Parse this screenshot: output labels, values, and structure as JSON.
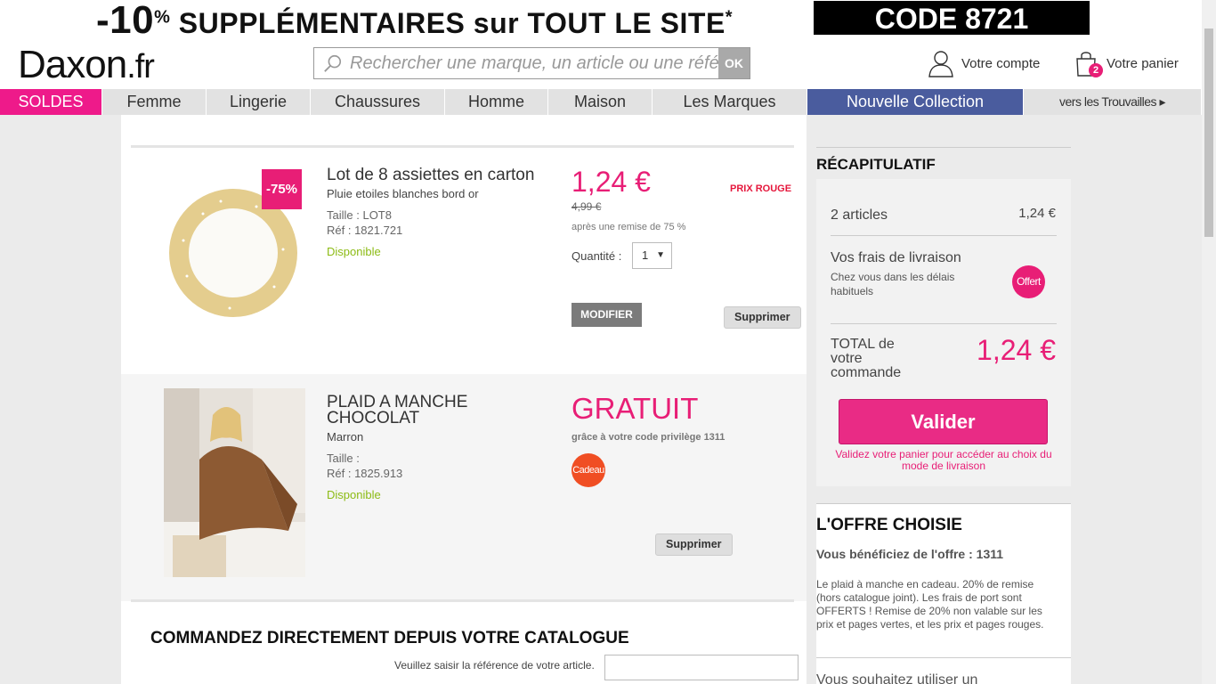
{
  "promo": {
    "percent": "-10",
    "percent_sign": "%",
    "text": " SUPPLÉMENTAIRES sur TOUT LE SITE",
    "asterisk": "*",
    "code": "CODE 8721"
  },
  "header": {
    "logo_main": "Daxon",
    "logo_suffix": ".fr",
    "search_placeholder": "Rechercher une marque, un article ou une référence",
    "search_ok": "OK",
    "account_label": "Votre compte",
    "cart_label": "Votre panier",
    "cart_count": "2"
  },
  "nav": {
    "items": [
      {
        "label": "SOLDES"
      },
      {
        "label": "Femme"
      },
      {
        "label": "Lingerie"
      },
      {
        "label": "Chaussures"
      },
      {
        "label": "Homme"
      },
      {
        "label": "Maison"
      },
      {
        "label": "Les Marques"
      },
      {
        "label": "Nouvelle Collection"
      },
      {
        "label": "vers les Trouvailles"
      }
    ],
    "trouvailles_arrow": "▸"
  },
  "cart_items": [
    {
      "discount_badge": "-75%",
      "title": "Lot de 8 assiettes en carton",
      "subtitle": "Pluie etoiles blanches bord or",
      "size": "Taille : LOT8",
      "ref": "Réf : 1821.721",
      "availability": "Disponible",
      "price": "1,24 €",
      "old_price": "4,99 €",
      "discount_note": "après une remise de 75 %",
      "price_label": "PRIX ROUGE",
      "quantity_label": "Quantité :",
      "quantity": "1",
      "modify": "MODIFIER",
      "remove": "Supprimer"
    },
    {
      "title": "PLAID A MANCHE CHOCOLAT",
      "subtitle": "Marron",
      "size": "Taille :",
      "ref": "Réf : 1825.913",
      "availability": "Disponible",
      "price": "GRATUIT",
      "price_note": "grâce à votre code privilège 1311",
      "gift_badge": "Cadeau",
      "remove": "Supprimer"
    }
  ],
  "recap": {
    "title": "RÉCAPITULATIF",
    "articles_label": "2 articles",
    "articles_value": "1,24 €",
    "shipping_label": "Vos frais de livraison",
    "shipping_note": "Chez vous dans les délais habituels",
    "shipping_badge": "Offert",
    "total_label": "TOTAL de votre commande",
    "total_value": "1,24 €",
    "validate_button": "Valider",
    "validate_note": "Validez votre panier pour accéder au choix du mode de livraison"
  },
  "offer": {
    "title": "L'OFFRE CHOISIE",
    "subtitle": "Vous bénéficiez de l'offre : 1311",
    "description": "Le plaid à manche en cadeau. 20% de remise (hors catalogue joint). Les frais de port sont OFFERTS ! Remise de 20% non valable sur les prix et pages vertes, et les prix et pages rouges.",
    "more": "Vous souhaitez utiliser un"
  },
  "catalogue": {
    "title": "COMMANDEZ DIRECTEMENT DEPUIS VOTRE CATALOGUE",
    "ref_label": "Veuillez saisir la référence de votre article."
  },
  "colors": {
    "brand_pink": "#e81e76",
    "nav_blue": "#4a5c9e",
    "available_green": "#8cbb14"
  }
}
